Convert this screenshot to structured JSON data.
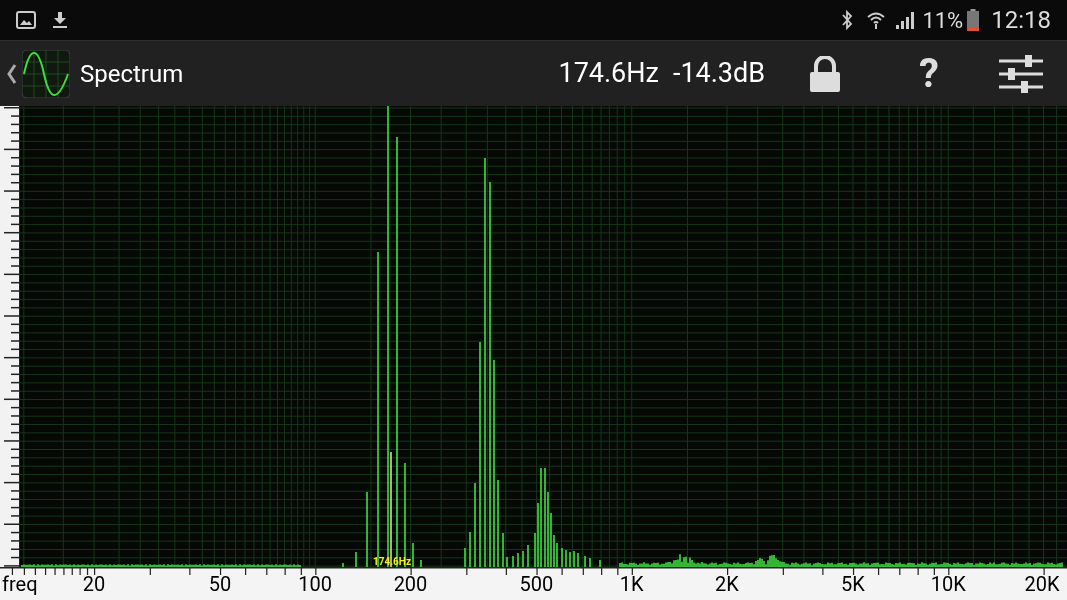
{
  "status_bar": {
    "battery_text": "11%",
    "time": "12:18"
  },
  "app_bar": {
    "title": "Spectrum",
    "frequency": "174.6Hz",
    "level_db": "-14.3dB",
    "help": "?"
  },
  "plot": {
    "peak_label": "174.6Hz",
    "x_axis_title": "freq",
    "x_axis_labels": [
      "20",
      "50",
      "100",
      "200",
      "500",
      "1K",
      "2K",
      "5K",
      "10K",
      "20K"
    ]
  }
}
